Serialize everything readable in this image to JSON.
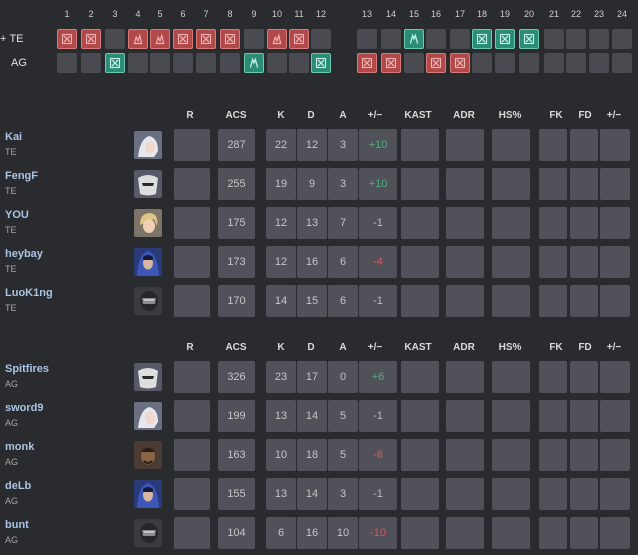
{
  "rounds": {
    "numbers": [
      "1",
      "2",
      "3",
      "4",
      "5",
      "6",
      "7",
      "8",
      "9",
      "10",
      "11",
      "12",
      "13",
      "14",
      "15",
      "16",
      "17",
      "18",
      "19",
      "20",
      "21",
      "22",
      "23",
      "24"
    ],
    "teams": [
      {
        "label": "TE",
        "prefix": "+",
        "results": [
          "red-x",
          "red-x",
          "none",
          "red-flame",
          "red-flame",
          "red-x",
          "red-x",
          "red-x",
          "none",
          "red-flame",
          "red-x",
          "none",
          "none",
          "none",
          "teal-defuse",
          "none",
          "none",
          "teal-x",
          "teal-x",
          "teal-x",
          "none",
          "none",
          "none",
          "none"
        ]
      },
      {
        "label": "AG",
        "prefix": "",
        "results": [
          "none",
          "none",
          "teal-x",
          "none",
          "none",
          "none",
          "none",
          "none",
          "teal-defuse",
          "none",
          "none",
          "teal-x",
          "red-x",
          "red-x",
          "none",
          "red-x",
          "red-x",
          "none",
          "none",
          "none",
          "none",
          "none",
          "none",
          "none"
        ]
      }
    ]
  },
  "columns": [
    "R",
    "ACS",
    "K",
    "D",
    "A",
    "+/−",
    "KAST",
    "ADR",
    "HS%",
    "FK",
    "FD",
    "+/−"
  ],
  "teams": [
    {
      "players": [
        {
          "name": "Kai",
          "team": "TE",
          "acs": "287",
          "k": "22",
          "d": "12",
          "a": "3",
          "pm": "+10",
          "pm_type": "pos",
          "agent": "silver-hair"
        },
        {
          "name": "FengF",
          "team": "TE",
          "acs": "255",
          "k": "19",
          "d": "9",
          "a": "3",
          "pm": "+10",
          "pm_type": "pos",
          "agent": "mask"
        },
        {
          "name": "YOU",
          "team": "TE",
          "acs": "175",
          "k": "12",
          "d": "13",
          "a": "7",
          "pm": "-1",
          "pm_type": "neu",
          "agent": "blonde"
        },
        {
          "name": "heybay",
          "team": "TE",
          "acs": "173",
          "k": "12",
          "d": "16",
          "a": "6",
          "pm": "-4",
          "pm_type": "neg",
          "agent": "blue-hood"
        },
        {
          "name": "LuoK1ng",
          "team": "TE",
          "acs": "170",
          "k": "14",
          "d": "15",
          "a": "6",
          "pm": "-1",
          "pm_type": "neu",
          "agent": "helmet"
        }
      ]
    },
    {
      "players": [
        {
          "name": "Spitfires",
          "team": "AG",
          "acs": "326",
          "k": "23",
          "d": "17",
          "a": "0",
          "pm": "+6",
          "pm_type": "pos",
          "agent": "mask"
        },
        {
          "name": "sword9",
          "team": "AG",
          "acs": "199",
          "k": "13",
          "d": "14",
          "a": "5",
          "pm": "-1",
          "pm_type": "neu",
          "agent": "silver-hair"
        },
        {
          "name": "monk",
          "team": "AG",
          "acs": "163",
          "k": "10",
          "d": "18",
          "a": "5",
          "pm": "-8",
          "pm_type": "neg",
          "agent": "dark-face"
        },
        {
          "name": "deLb",
          "team": "AG",
          "acs": "155",
          "k": "13",
          "d": "14",
          "a": "3",
          "pm": "-1",
          "pm_type": "neu",
          "agent": "blue-hood"
        },
        {
          "name": "bunt",
          "team": "AG",
          "acs": "104",
          "k": "6",
          "d": "16",
          "a": "10",
          "pm": "-10",
          "pm_type": "neg",
          "agent": "helmet"
        }
      ]
    }
  ]
}
